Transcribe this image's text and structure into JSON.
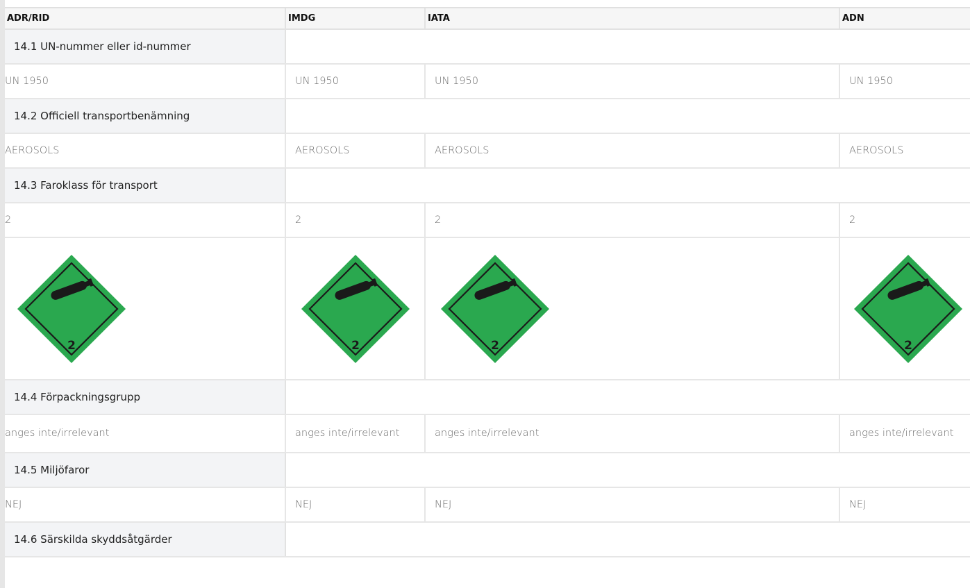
{
  "columns": [
    "ADR/RID",
    "IMDG",
    "IATA",
    "ADN"
  ],
  "sections": [
    {
      "title": "14.1 UN-nummer eller id-nummer",
      "values": [
        "UN 1950",
        "UN 1950",
        "UN 1950",
        "UN 1950"
      ]
    },
    {
      "title": "14.2 Officiell transportbenämning",
      "values": [
        "AEROSOLS",
        "AEROSOLS",
        "AEROSOLS",
        "AEROSOLS"
      ]
    },
    {
      "title": "14.3 Faroklass för transport",
      "values": [
        "2",
        "2",
        "2",
        "2"
      ]
    },
    {
      "title": "14.4 Förpackningsgrupp",
      "values": [
        "anges inte/irrelevant",
        "anges inte/irrelevant",
        "anges inte/irrelevant",
        "anges inte/irrelevant"
      ]
    },
    {
      "title": "14.5 Miljöfaror",
      "values": [
        "NEJ",
        "NEJ",
        "NEJ",
        "NEJ"
      ]
    },
    {
      "title": "14.6 Särskilda skyddsåtgärder"
    }
  ],
  "placard": {
    "label": "2",
    "icon": "gas-cylinder-placard-icon",
    "fill": "#2aa84f",
    "border": "#1a1a1a"
  },
  "colors": {
    "header_bg": "#f6f6f6",
    "section_bg": "#f3f4f6",
    "grid": "#e2e2e2",
    "value_text": "#6b6b6b"
  }
}
